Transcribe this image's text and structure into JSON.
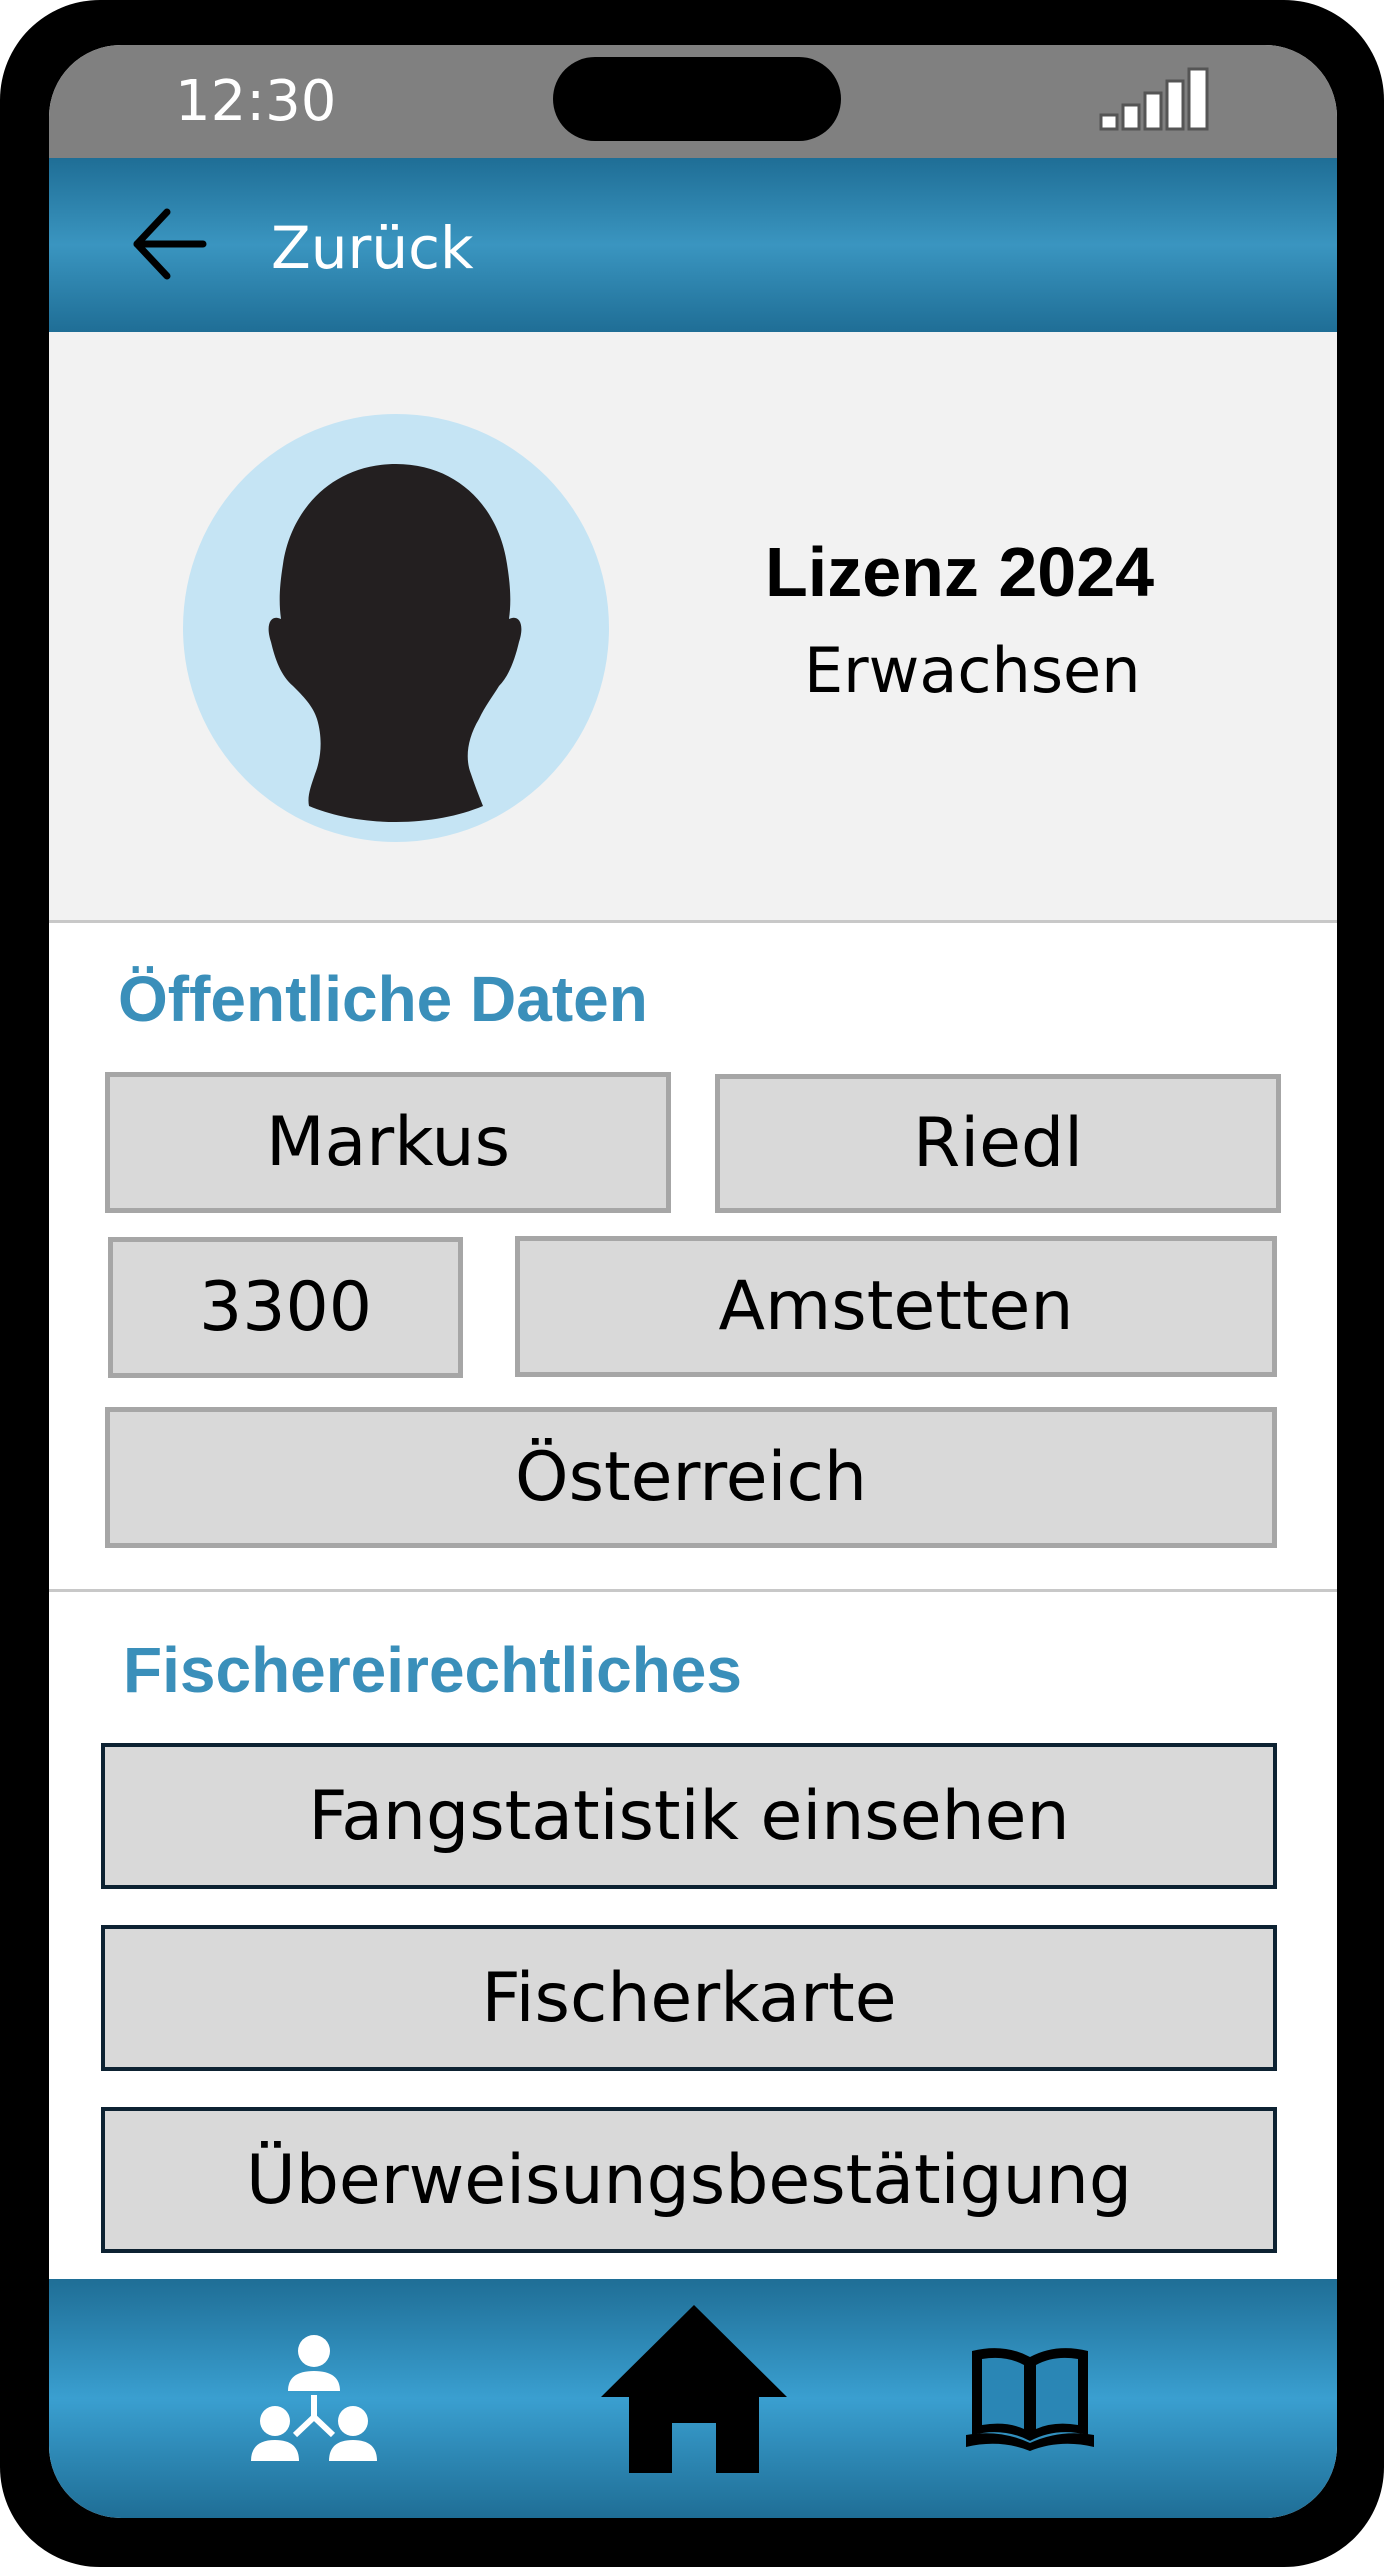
{
  "status_bar": {
    "time": "12:30",
    "signal_icon": "signal-bars-icon"
  },
  "header": {
    "back_icon": "arrow-left-icon",
    "back_label": "Zurück"
  },
  "profile": {
    "avatar_icon": "person-silhouette-icon",
    "license_title": "Lizenz 2024",
    "license_category": "Erwachsen"
  },
  "public_data": {
    "heading": "Öffentliche Daten",
    "first_name": "Markus",
    "last_name": "Riedl",
    "postal_code": "3300",
    "city": "Amstetten",
    "country": "Österreich"
  },
  "fishing_rights": {
    "heading": "Fischereirechtliches",
    "buttons": [
      {
        "label": "Fangstatistik einsehen"
      },
      {
        "label": "Fischerkarte"
      },
      {
        "label": "Überweisungsbestätigung"
      }
    ]
  },
  "bottom_nav": {
    "items": [
      {
        "icon": "community-icon"
      },
      {
        "icon": "home-icon"
      },
      {
        "icon": "book-icon"
      }
    ]
  },
  "colors": {
    "accent": "#3a8fba",
    "header_blue": "#2a82ad",
    "field_bg": "#d9d9d9",
    "avatar_bg": "#c5e4f4"
  }
}
